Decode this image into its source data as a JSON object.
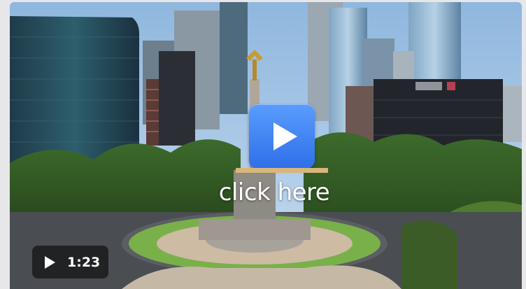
{
  "video": {
    "overlay_text": "click here",
    "duration": "1:23",
    "scene": "aerial-city-monument",
    "colors": {
      "play_button": "#3f84f7",
      "accent_bar": "#d9b67a",
      "text": "#ffffff",
      "duration_bg": "#1a1a1a"
    }
  },
  "icons": {
    "big_play": "play-icon",
    "small_play": "play-icon"
  }
}
